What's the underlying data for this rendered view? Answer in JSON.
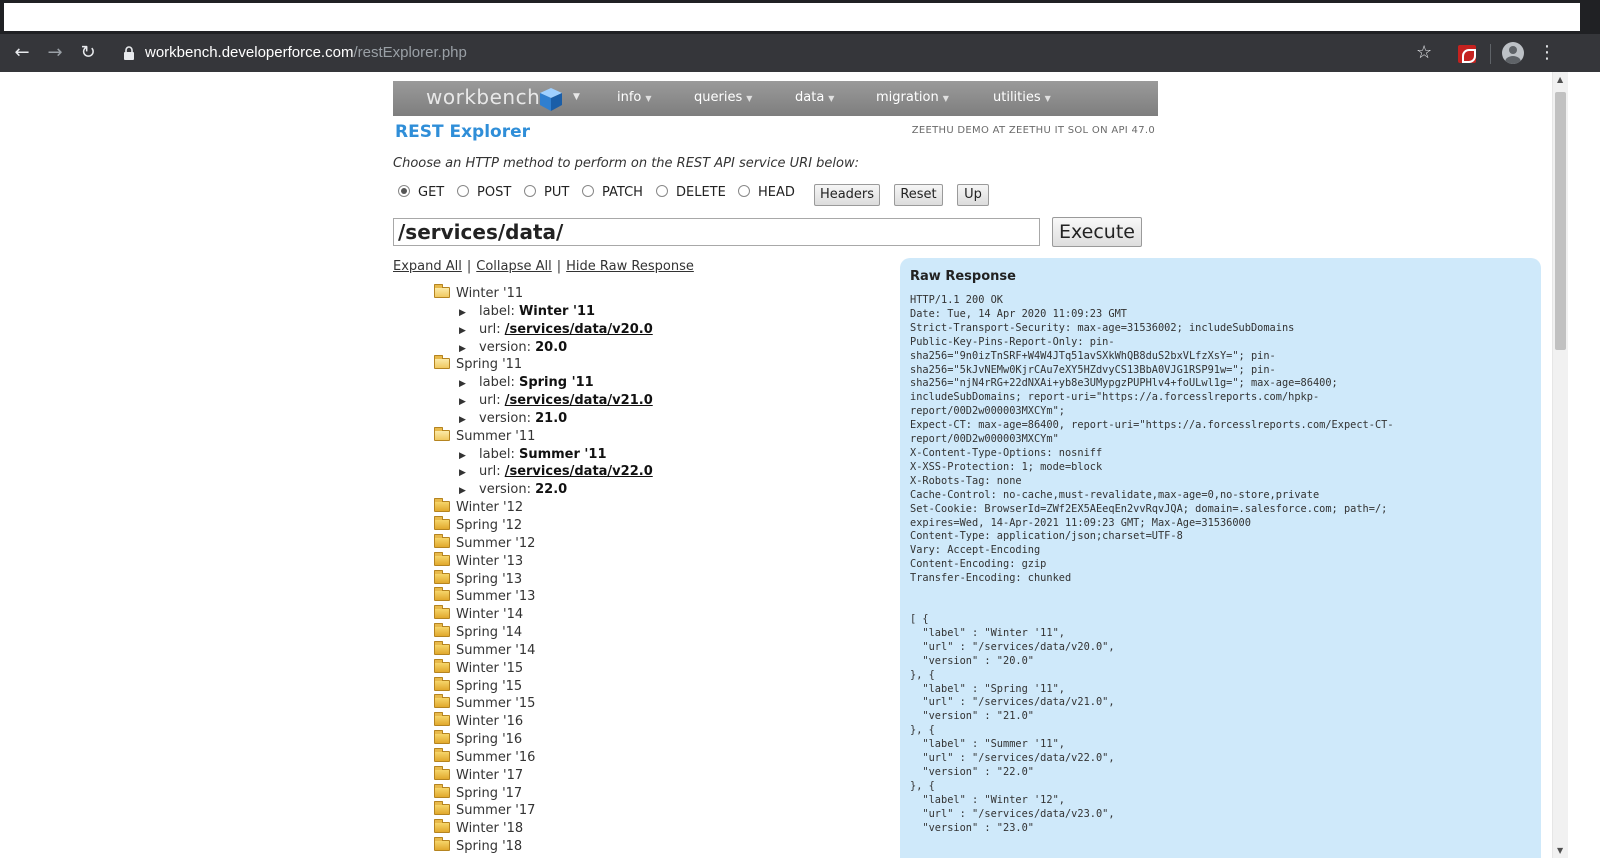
{
  "browser": {
    "url_host": "workbench.developerforce.com",
    "url_path": "/restExplorer.php"
  },
  "nav": {
    "logo": "workbench",
    "items": [
      "info",
      "queries",
      "data",
      "migration",
      "utilities"
    ]
  },
  "header": {
    "title": "REST Explorer",
    "user_info": "ZEETHU DEMO AT ZEETHU IT SOL ON API 47.0"
  },
  "form": {
    "instruction": "Choose an HTTP method to perform on the REST API service URI below:",
    "methods": [
      "GET",
      "POST",
      "PUT",
      "PATCH",
      "DELETE",
      "HEAD"
    ],
    "selected_method": "GET",
    "buttons": {
      "headers": "Headers",
      "reset": "Reset",
      "up": "Up"
    },
    "uri": "/services/data/",
    "execute": "Execute"
  },
  "links": {
    "expand": "Expand All",
    "collapse": "Collapse All",
    "hide_raw": "Hide Raw Response",
    "separator": "|"
  },
  "tree": {
    "expanded": [
      {
        "name": "Winter '11",
        "label_key": "label:",
        "label": "Winter '11",
        "url_key": "url:",
        "url": "/services/data/v20.0",
        "version_key": "version:",
        "version": "20.0"
      },
      {
        "name": "Spring '11",
        "label_key": "label:",
        "label": "Spring '11",
        "url_key": "url:",
        "url": "/services/data/v21.0",
        "version_key": "version:",
        "version": "21.0"
      },
      {
        "name": "Summer '11",
        "label_key": "label:",
        "label": "Summer '11",
        "url_key": "url:",
        "url": "/services/data/v22.0",
        "version_key": "version:",
        "version": "22.0"
      }
    ],
    "collapsed": [
      "Winter '12",
      "Spring '12",
      "Summer '12",
      "Winter '13",
      "Spring '13",
      "Summer '13",
      "Winter '14",
      "Spring '14",
      "Summer '14",
      "Winter '15",
      "Spring '15",
      "Summer '15",
      "Winter '16",
      "Spring '16",
      "Summer '16",
      "Winter '17",
      "Spring '17",
      "Summer '17",
      "Winter '18",
      "Spring '18"
    ]
  },
  "raw": {
    "title": "Raw Response",
    "headers": "HTTP/1.1 200 OK\nDate: Tue, 14 Apr 2020 11:09:23 GMT\nStrict-Transport-Security: max-age=31536002; includeSubDomains\nPublic-Key-Pins-Report-Only: pin-\nsha256=\"9n0izTnSRF+W4W4JTq51avSXkWhQB8duS2bxVLfzXsY=\"; pin-\nsha256=\"5kJvNEMw0KjrCAu7eXY5HZdvyCS13BbA0VJG1RSP91w=\"; pin-\nsha256=\"njN4rRG+22dNXAi+yb8e3UMypgzPUPHlv4+foULwl1g=\"; max-age=86400;\nincludeSubDomains; report-uri=\"https://a.forcesslreports.com/hpkp-\nreport/00D2w000003MXCYm\";\nExpect-CT: max-age=86400, report-uri=\"https://a.forcesslreports.com/Expect-CT-\nreport/00D2w000003MXCYm\"\nX-Content-Type-Options: nosniff\nX-XSS-Protection: 1; mode=block\nX-Robots-Tag: none\nCache-Control: no-cache,must-revalidate,max-age=0,no-store,private\nSet-Cookie: BrowserId=ZWf2EX5AEeqEn2vvRqvJQA; domain=.salesforce.com; path=/;\nexpires=Wed, 14-Apr-2021 11:09:23 GMT; Max-Age=31536000\nContent-Type: application/json;charset=UTF-8\nVary: Accept-Encoding\nContent-Encoding: gzip\nTransfer-Encoding: chunked",
    "body": "[ {\n  \"label\" : \"Winter '11\",\n  \"url\" : \"/services/data/v20.0\",\n  \"version\" : \"20.0\"\n}, {\n  \"label\" : \"Spring '11\",\n  \"url\" : \"/services/data/v21.0\",\n  \"version\" : \"21.0\"\n}, {\n  \"label\" : \"Summer '11\",\n  \"url\" : \"/services/data/v22.0\",\n  \"version\" : \"22.0\"\n}, {\n  \"label\" : \"Winter '12\",\n  \"url\" : \"/services/data/v23.0\",\n  \"version\" : \"23.0\""
  }
}
